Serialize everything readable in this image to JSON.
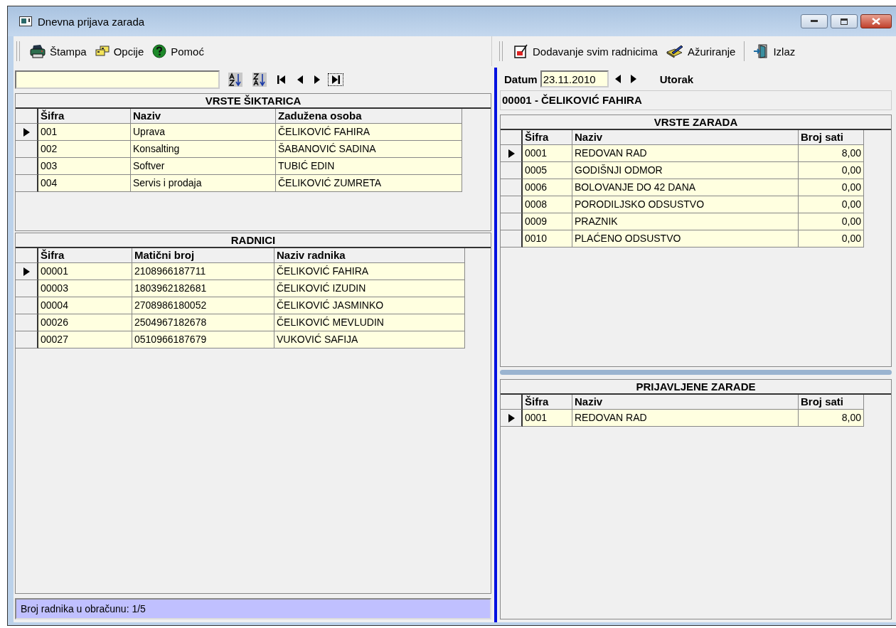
{
  "window": {
    "title": "Dnevna prijava zarada"
  },
  "toolbar_left": [
    {
      "label": "Štampa",
      "kind": "printer"
    },
    {
      "label": "Opcije",
      "kind": "cards"
    },
    {
      "label": "Pomoć",
      "kind": "help"
    }
  ],
  "toolbar_right": [
    {
      "label": "Dodavanje svim radnicima",
      "kind": "report"
    },
    {
      "label": "Ažuriranje",
      "kind": "pencil"
    },
    {
      "label": "Izlaz",
      "kind": "exit"
    }
  ],
  "vrste_siktarica": {
    "title": "VRSTE ŠIKTARICA",
    "columns": [
      "Šifra",
      "Naziv",
      "Zadužena osoba"
    ],
    "rows": [
      {
        "selected": true,
        "cells": [
          "001",
          "Uprava",
          "ČELIKOVIĆ FAHIRA"
        ]
      },
      {
        "selected": false,
        "cells": [
          "002",
          "Konsalting",
          "ŠABANOVIĆ SADINA"
        ]
      },
      {
        "selected": false,
        "cells": [
          "003",
          "Softver",
          "TUBIĆ EDIN"
        ]
      },
      {
        "selected": false,
        "cells": [
          "004",
          "Servis i prodaja",
          "ČELIKOVIĆ ZUMRETA"
        ]
      }
    ]
  },
  "radnici": {
    "title": "RADNICI",
    "columns": [
      "Šifra",
      "Matični broj",
      "Naziv radnika"
    ],
    "rows": [
      {
        "selected": true,
        "cells": [
          "00001",
          "2108966187711",
          "ČELIKOVIĆ FAHIRA"
        ]
      },
      {
        "selected": false,
        "cells": [
          "00003",
          "1803962182681",
          "ČELIKOVIĆ IZUDIN"
        ]
      },
      {
        "selected": false,
        "cells": [
          "00004",
          "2708986180052",
          "ČELIKOVIĆ JASMINKO"
        ]
      },
      {
        "selected": false,
        "cells": [
          "00026",
          "2504967182678",
          "ČELIKOVIĆ MEVLUDIN"
        ]
      },
      {
        "selected": false,
        "cells": [
          "00027",
          "0510966187679",
          "VUKOVIĆ SAFIJA"
        ]
      }
    ]
  },
  "status_bar": "Broj radnika u obračunu: 1/5",
  "date": {
    "label": "Datum",
    "value": "23.11.2010",
    "day": "Utorak"
  },
  "employee_header": "00001 - ČELIKOVIĆ FAHIRA",
  "vrste_zarada": {
    "title": "VRSTE ZARADA",
    "columns": [
      "Šifra",
      "Naziv",
      "Broj sati"
    ],
    "rows": [
      {
        "selected": true,
        "cells": [
          "0001",
          "REDOVAN RAD",
          "8,00"
        ]
      },
      {
        "selected": false,
        "cells": [
          "0005",
          "GODIŠNJI ODMOR",
          "0,00"
        ]
      },
      {
        "selected": false,
        "cells": [
          "0006",
          "BOLOVANJE DO 42 DANA",
          "0,00"
        ]
      },
      {
        "selected": false,
        "cells": [
          "0008",
          "PORODILJSKO ODSUSTVO",
          "0,00"
        ]
      },
      {
        "selected": false,
        "cells": [
          "0009",
          "PRAZNIK",
          "0,00"
        ]
      },
      {
        "selected": false,
        "cells": [
          "0010",
          "PLAĆENO ODSUSTVO",
          "0,00"
        ]
      }
    ]
  },
  "prijavljene_zarade": {
    "title": "PRIJAVLJENE ZARADE",
    "columns": [
      "Šifra",
      "Naziv",
      "Broj sati"
    ],
    "rows": [
      {
        "selected": true,
        "cells": [
          "0001",
          "REDOVAN RAD",
          "8,00"
        ]
      }
    ]
  }
}
